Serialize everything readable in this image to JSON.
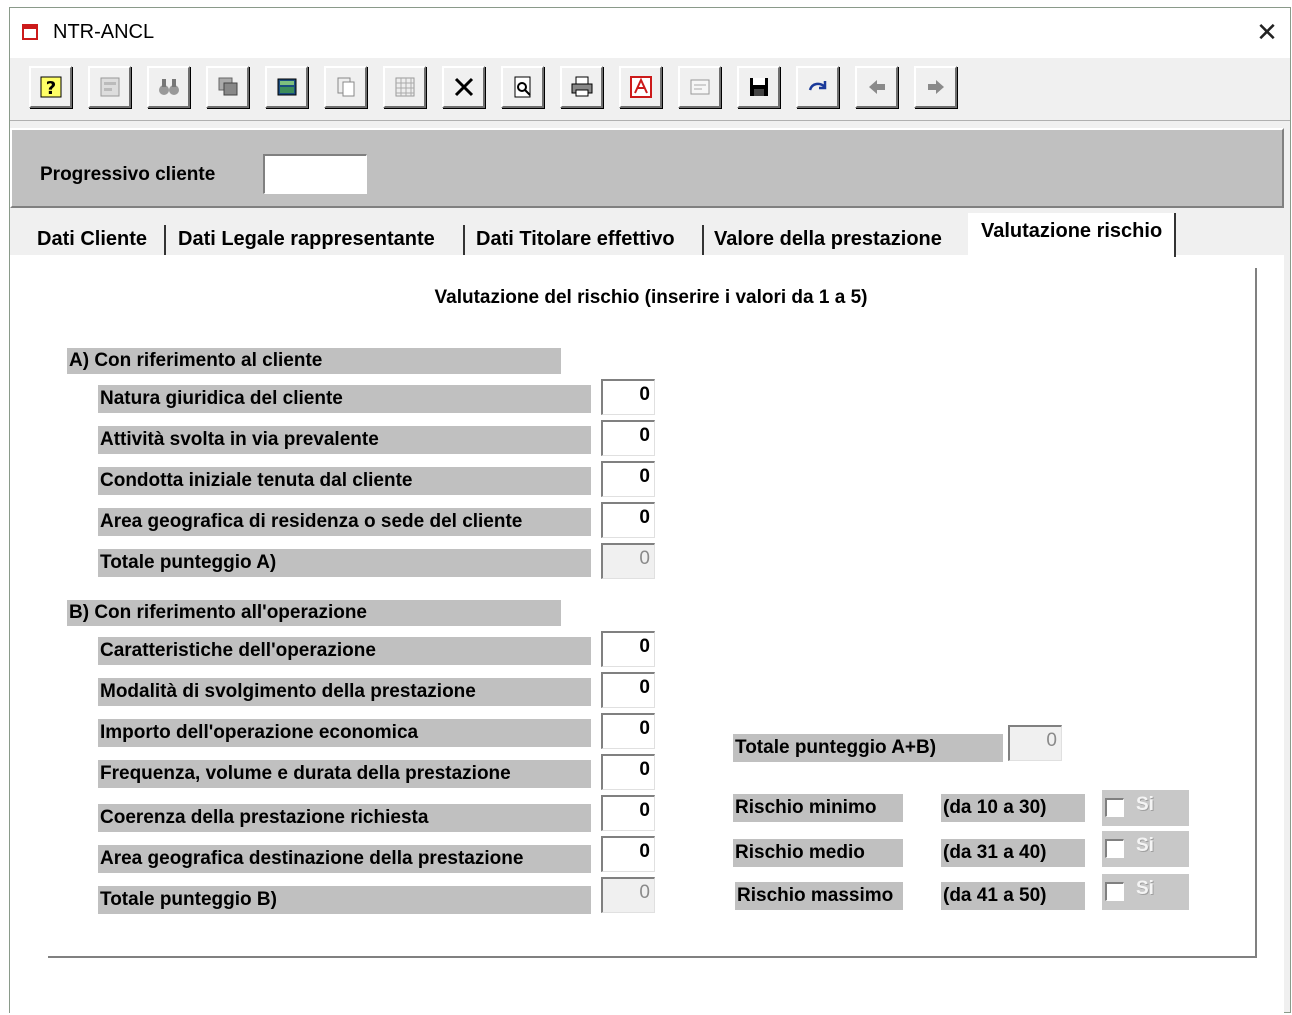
{
  "window": {
    "title": "NTR-ANCL",
    "close_glyph": "✕"
  },
  "toolbar": {
    "buttons": [
      {
        "name": "help-button",
        "icon": "question-icon"
      },
      {
        "name": "properties-button",
        "icon": "properties-icon"
      },
      {
        "name": "find-button",
        "icon": "binoculars-icon"
      },
      {
        "name": "copy-window-button",
        "icon": "windows-icon"
      },
      {
        "name": "calculator-button",
        "icon": "calculator-icon"
      },
      {
        "name": "paste-button",
        "icon": "paste-icon"
      },
      {
        "name": "grid-button",
        "icon": "grid-icon"
      },
      {
        "name": "delete-button",
        "icon": "x-icon"
      },
      {
        "name": "preview-button",
        "icon": "print-preview-icon"
      },
      {
        "name": "print-button",
        "icon": "printer-icon"
      },
      {
        "name": "pdf-button",
        "icon": "pdf-icon"
      },
      {
        "name": "form-button",
        "icon": "form-icon"
      },
      {
        "name": "save-button",
        "icon": "floppy-icon"
      },
      {
        "name": "redo-button",
        "icon": "redo-icon"
      },
      {
        "name": "prev-button",
        "icon": "arrow-left-icon"
      },
      {
        "name": "next-button",
        "icon": "arrow-right-icon"
      }
    ]
  },
  "header": {
    "progressivo_label": "Progressivo cliente",
    "progressivo_value": ""
  },
  "tabs": [
    "Dati Cliente",
    "Dati Legale rappresentante",
    "Dati Titolare effettivo",
    "Valore della prestazione",
    "Valutazione rischio"
  ],
  "active_tab": "Valutazione rischio",
  "panel": {
    "banner": "Valutazione del rischio (inserire i valori da 1 a 5)",
    "section_a": {
      "title": "A) Con riferimento al cliente",
      "rows": [
        {
          "label": "Natura giuridica del cliente",
          "value": "0"
        },
        {
          "label": "Attività svolta in via prevalente",
          "value": "0"
        },
        {
          "label": "Condotta iniziale tenuta dal cliente",
          "value": "0"
        },
        {
          "label": "Area geografica di residenza o sede del cliente",
          "value": "0"
        }
      ],
      "total_label": "Totale punteggio A)",
      "total_value": "0"
    },
    "section_b": {
      "title": "B) Con riferimento all'operazione",
      "rows": [
        {
          "label": "Caratteristiche dell'operazione",
          "value": "0"
        },
        {
          "label": "Modalità di svolgimento della prestazione",
          "value": "0"
        },
        {
          "label": "Importo dell'operazione economica",
          "value": "0"
        },
        {
          "label": "Frequenza, volume e durata della prestazione",
          "value": "0"
        },
        {
          "label": "Coerenza della prestazione richiesta",
          "value": "0"
        },
        {
          "label": "Area geografica destinazione della prestazione",
          "value": "0"
        }
      ],
      "total_label": "Totale punteggio B)",
      "total_value": "0"
    },
    "total_ab": {
      "label": "Totale punteggio A+B)",
      "value": "0"
    },
    "risk": [
      {
        "label": "Rischio minimo",
        "range": "(da 10 a 30)",
        "check_label": "Si",
        "checked": false
      },
      {
        "label": "Rischio medio",
        "range": "(da 31 a 40)",
        "check_label": "Si",
        "checked": false
      },
      {
        "label": "Rischio massimo",
        "range": "(da 41 a 50)",
        "check_label": "Si",
        "checked": false
      }
    ]
  },
  "colors": {
    "panel_grey": "#c0c0c0",
    "label_grey": "#c0c0c0",
    "app_icon_red": "#cc1a1a"
  }
}
